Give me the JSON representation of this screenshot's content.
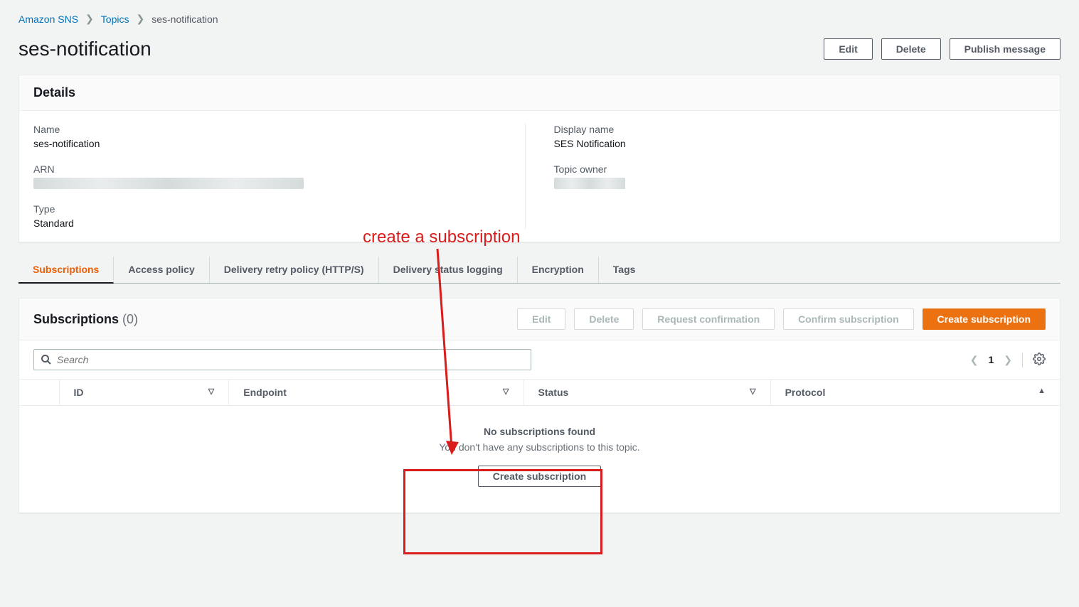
{
  "breadcrumb": {
    "root": "Amazon SNS",
    "section": "Topics",
    "current": "ses-notification"
  },
  "page_title": "ses-notification",
  "header_buttons": {
    "edit": "Edit",
    "delete": "Delete",
    "publish": "Publish message"
  },
  "details": {
    "title": "Details",
    "name_label": "Name",
    "name_value": "ses-notification",
    "arn_label": "ARN",
    "type_label": "Type",
    "type_value": "Standard",
    "display_name_label": "Display name",
    "display_name_value": "SES Notification",
    "topic_owner_label": "Topic owner"
  },
  "tabs": {
    "subscriptions": "Subscriptions",
    "access_policy": "Access policy",
    "delivery_retry": "Delivery retry policy (HTTP/S)",
    "delivery_status": "Delivery status logging",
    "encryption": "Encryption",
    "tags": "Tags"
  },
  "subscriptions": {
    "title": "Subscriptions",
    "count": "(0)",
    "buttons": {
      "edit": "Edit",
      "delete": "Delete",
      "request": "Request confirmation",
      "confirm": "Confirm subscription",
      "create": "Create subscription"
    },
    "search_placeholder": "Search",
    "page": "1",
    "columns": {
      "id": "ID",
      "endpoint": "Endpoint",
      "status": "Status",
      "protocol": "Protocol"
    },
    "empty_title": "No subscriptions found",
    "empty_desc": "You don't have any subscriptions to this topic.",
    "empty_btn": "Create subscription"
  },
  "annotation_text": "create a subscription"
}
